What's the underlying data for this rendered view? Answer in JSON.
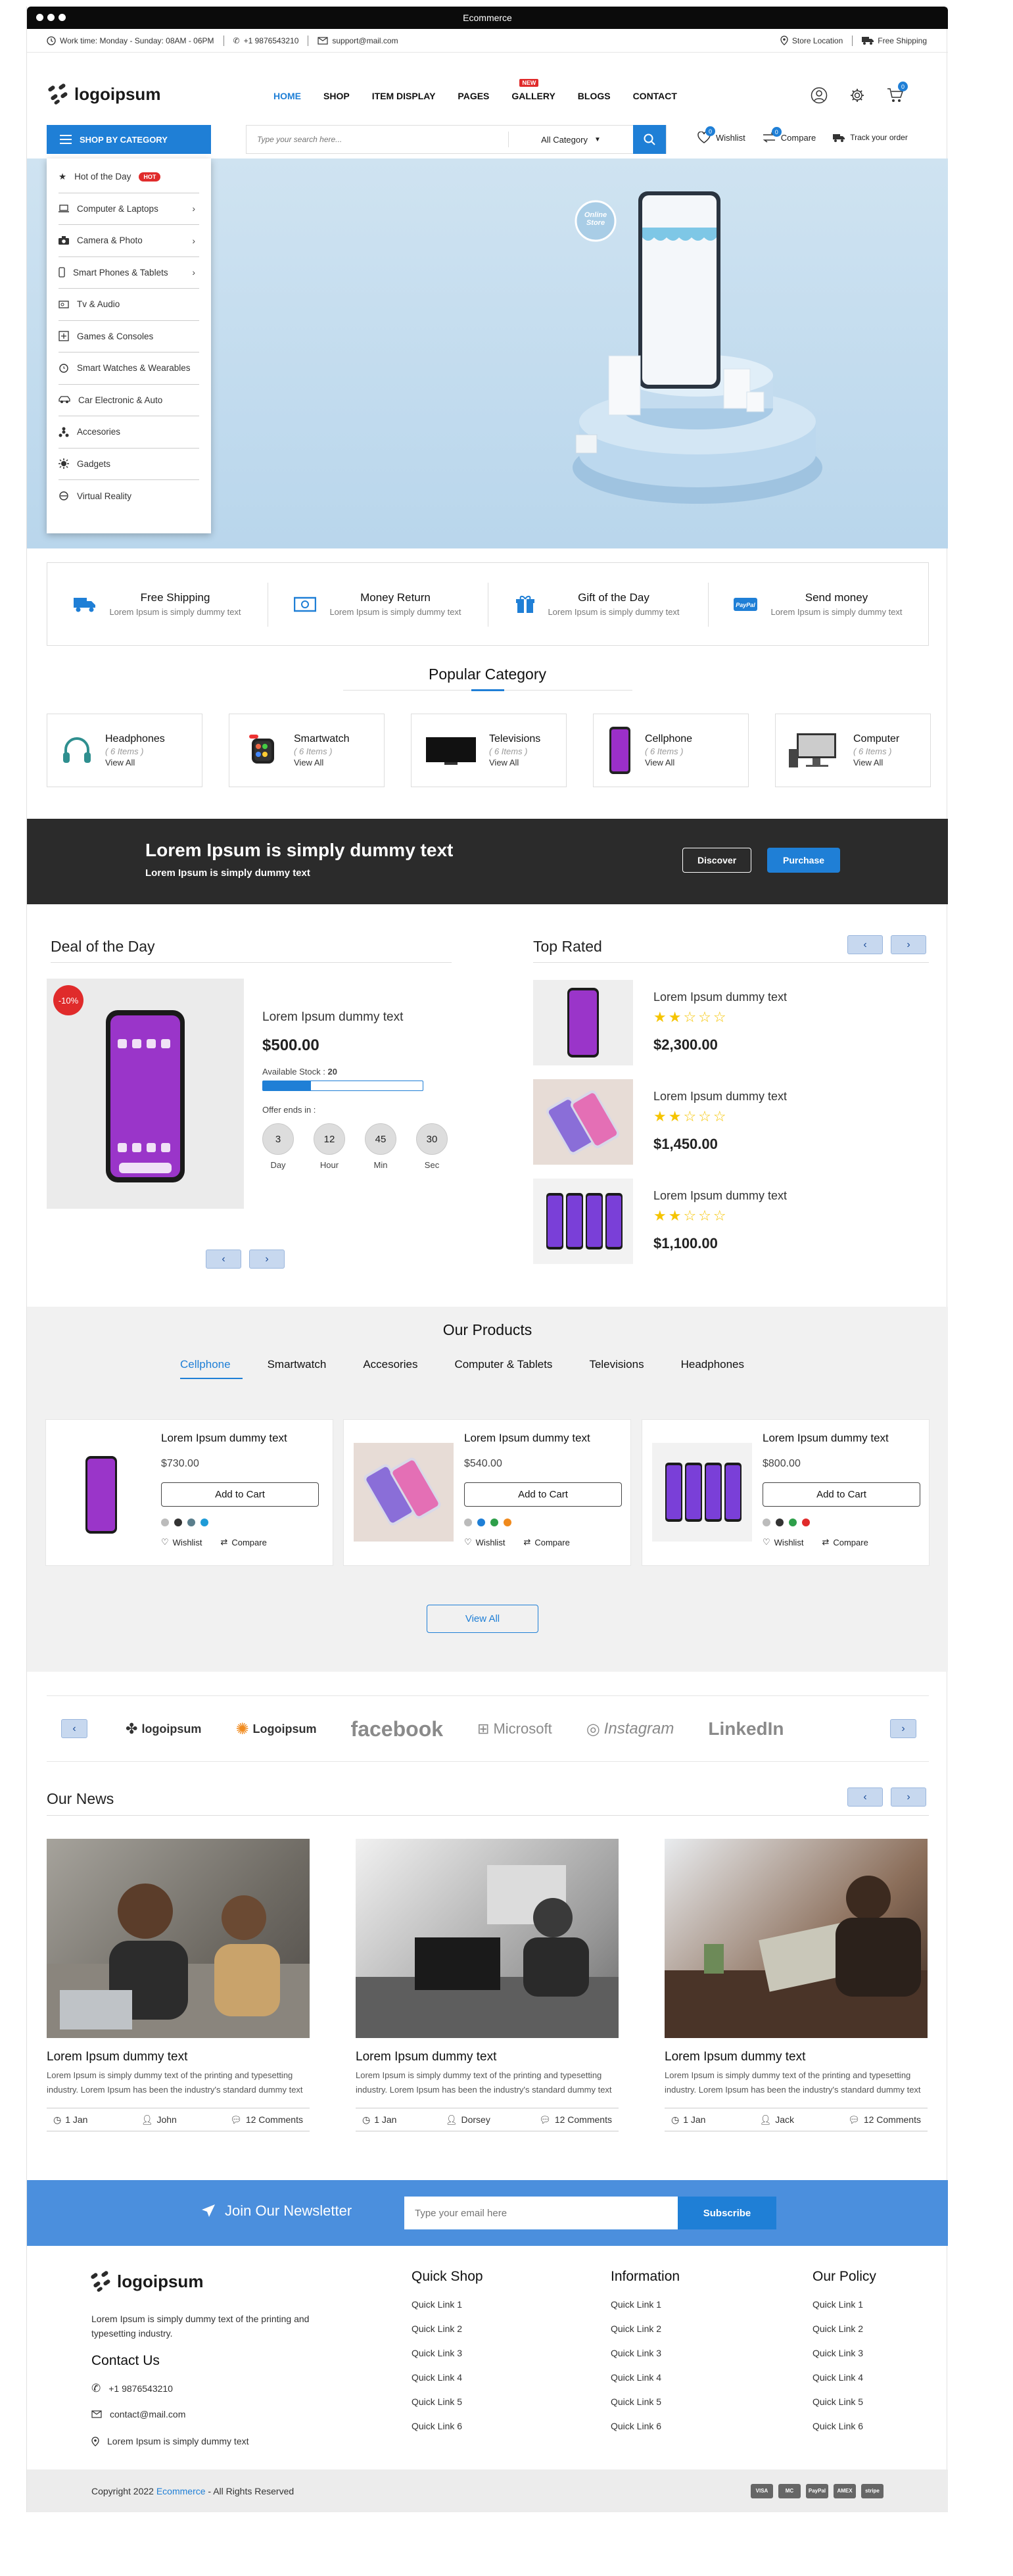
{
  "window": {
    "title": "Ecommerce"
  },
  "topbar": {
    "work_time": "Work time: Monday - Sunday: 08AM - 06PM",
    "phone": "+1 9876543210",
    "email": "support@mail.com",
    "store_location": "Store Location",
    "free_shipping": "Free Shipping"
  },
  "header": {
    "logo": "logoipsum",
    "nav": [
      "HOME",
      "SHOP",
      "ITEM DISPLAY",
      "PAGES",
      "GALLERY",
      "BLOGS",
      "CONTACT"
    ],
    "gallery_badge": "NEW",
    "cart_count": "0"
  },
  "searchbar": {
    "category_button": "SHOP BY CATEGORY",
    "placeholder": "Type your search here...",
    "category_select": "All Category",
    "wishlist": "Wishlist",
    "wishlist_count": "0",
    "compare": "Compare",
    "compare_count": "0",
    "track": "Track your order"
  },
  "category_menu": {
    "items": [
      "Hot of the Day",
      "Computer & Laptops",
      "Camera & Photo",
      "Smart Phones & Tablets",
      "Tv & Audio",
      "Games & Consoles",
      "Smart Watches & Wearables",
      "Car Electronic & Auto",
      "Accesories",
      "Gadgets",
      "Virtual Reality"
    ],
    "hot_badge": "HOT"
  },
  "hero": {
    "badge": "Online Store"
  },
  "features": [
    {
      "title": "Free Shipping",
      "subtitle": "Lorem Ipsum is simply dummy text"
    },
    {
      "title": "Money Return",
      "subtitle": "Lorem Ipsum is simply dummy text"
    },
    {
      "title": "Gift of the Day",
      "subtitle": "Lorem Ipsum is simply dummy text"
    },
    {
      "title": "Send money",
      "subtitle": "Lorem Ipsum is simply dummy text"
    }
  ],
  "popular_category": {
    "title": "Popular Category",
    "items": [
      {
        "name": "Headphones",
        "count": "( 6 Items )",
        "link": "View All"
      },
      {
        "name": "Smartwatch",
        "count": "( 6 Items )",
        "link": "View All"
      },
      {
        "name": "Televisions",
        "count": "( 6 Items )",
        "link": "View All"
      },
      {
        "name": "Cellphone",
        "count": "( 6 Items )",
        "link": "View All"
      },
      {
        "name": "Computer",
        "count": "( 6 Items )",
        "link": "View All"
      }
    ]
  },
  "banner": {
    "headline": "Lorem Ipsum is simply dummy text",
    "sub": "Lorem Ipsum is simply dummy text",
    "discover": "Discover",
    "purchase": "Purchase"
  },
  "deal": {
    "title": "Deal of the Day",
    "discount": "-10%",
    "name": "Lorem Ipsum dummy text",
    "price": "$500.00",
    "stock_label": "Available Stock :",
    "stock_value": "20",
    "stock_fraction": 0.3,
    "offer_label": "Offer ends in :",
    "timer": [
      {
        "value": "3",
        "label": "Day"
      },
      {
        "value": "12",
        "label": "Hour"
      },
      {
        "value": "45",
        "label": "Min"
      },
      {
        "value": "30",
        "label": "Sec"
      }
    ]
  },
  "top_rated": {
    "title": "Top Rated",
    "items": [
      {
        "name": "Lorem Ipsum dummy text",
        "price": "$2,300.00",
        "rating": 2
      },
      {
        "name": "Lorem Ipsum dummy text",
        "price": "$1,450.00",
        "rating": 2
      },
      {
        "name": "Lorem Ipsum dummy text",
        "price": "$1,100.00",
        "rating": 2
      }
    ]
  },
  "our_products": {
    "title": "Our Products",
    "tabs": [
      "Cellphone",
      "Smartwatch",
      "Accesories",
      "Computer & Tablets",
      "Televisions",
      "Headphones"
    ],
    "items": [
      {
        "name": "Lorem Ipsum dummy text",
        "price": "$730.00",
        "button": "Add to Cart",
        "wishlist": "Wishlist",
        "compare": "Compare",
        "swatches": [
          "#bbbbbb",
          "#333333",
          "#5a7e8c",
          "#1e9bd7"
        ]
      },
      {
        "name": "Lorem Ipsum dummy text",
        "price": "$540.00",
        "button": "Add to Cart",
        "wishlist": "Wishlist",
        "compare": "Compare",
        "swatches": [
          "#bbbbbb",
          "#1f7fd6",
          "#2e9f4a",
          "#f08a1d"
        ]
      },
      {
        "name": "Lorem Ipsum dummy text",
        "price": "$800.00",
        "button": "Add to Cart",
        "wishlist": "Wishlist",
        "compare": "Compare",
        "swatches": [
          "#bbbbbb",
          "#333333",
          "#2e9f4a",
          "#e02b2b"
        ]
      }
    ],
    "view_all": "View All"
  },
  "brands": [
    "logoipsum",
    "Logoipsum",
    "facebook",
    "Microsoft",
    "Instagram",
    "LinkedIn"
  ],
  "news": {
    "title": "Our News",
    "items": [
      {
        "title": "Lorem Ipsum dummy text",
        "desc": "Lorem Ipsum is simply dummy text of the printing and typesetting industry. Lorem Ipsum has been the industry's standard dummy text",
        "date": "1 Jan",
        "author": "John",
        "comments": "12 Comments"
      },
      {
        "title": "Lorem Ipsum dummy text",
        "desc": "Lorem Ipsum is simply dummy text of the printing and typesetting industry. Lorem Ipsum has been the industry's standard dummy text",
        "date": "1 Jan",
        "author": "Dorsey",
        "comments": "12 Comments"
      },
      {
        "title": "Lorem Ipsum dummy text",
        "desc": "Lorem Ipsum is simply dummy text of the printing and typesetting industry. Lorem Ipsum has been the industry's standard dummy text",
        "date": "1 Jan",
        "author": "Jack",
        "comments": "12 Comments"
      }
    ]
  },
  "newsletter": {
    "title": "Join Our Newsletter",
    "placeholder": "Type your email here",
    "button": "Subscribe"
  },
  "footer": {
    "logo": "logoipsum",
    "about": "Lorem Ipsum is simply dummy text of the printing and typesetting industry.",
    "contact_title": "Contact Us",
    "phone": "+1 9876543210",
    "email": "contact@mail.com",
    "address": "Lorem Ipsum is simply dummy text",
    "columns": [
      {
        "title": "Quick Shop",
        "links": [
          "Quick Link 1",
          "Quick Link 2",
          "Quick Link 3",
          "Quick Link 4",
          "Quick Link 5",
          "Quick Link 6"
        ]
      },
      {
        "title": "Information",
        "links": [
          "Quick Link 1",
          "Quick Link 2",
          "Quick Link 3",
          "Quick Link 4",
          "Quick Link 5",
          "Quick Link 6"
        ]
      },
      {
        "title": "Our Policy",
        "links": [
          "Quick Link 1",
          "Quick Link 2",
          "Quick Link 3",
          "Quick Link 4",
          "Quick Link 5",
          "Quick Link 6"
        ]
      }
    ],
    "copyright_prefix": "Copyright 2022",
    "copyright_brand": "Ecommerce",
    "copyright_suffix": "- All Rights Reserved",
    "payments": [
      "VISA",
      "MC",
      "PayPal",
      "AMEX",
      "stripe"
    ]
  },
  "colors": {
    "accent": "#1f7fd6",
    "dark": "#2b2b2b",
    "badge": "#e02b2b",
    "newsletter": "#4b8fdd"
  }
}
